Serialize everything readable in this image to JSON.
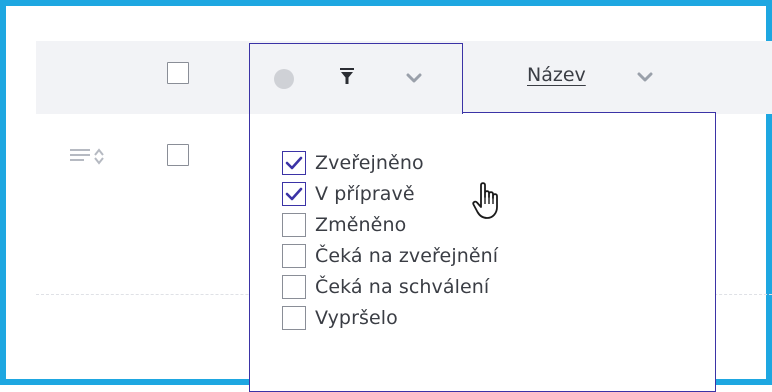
{
  "table": {
    "name_column": {
      "label": "Název"
    }
  },
  "status_filter": {
    "options": [
      {
        "label": "Zveřejněno",
        "checked": true
      },
      {
        "label": "V přípravě",
        "checked": true
      },
      {
        "label": "Změněno",
        "checked": false
      },
      {
        "label": "Čeká na zveřejnění",
        "checked": false
      },
      {
        "label": "Čeká na schválení",
        "checked": false
      },
      {
        "label": "Vypršelo",
        "checked": false
      }
    ]
  },
  "icons": {
    "status": "status-dot-icon",
    "filter": "filter-icon",
    "chevron": "chevron-down-icon",
    "row_sort": "drag-sort-icon",
    "cursor": "hand-pointer-cursor"
  },
  "colors": {
    "frame": "#1ea7e1",
    "accent": "#3b33a6",
    "header_bg": "#f2f3f6",
    "text": "#3a3d44"
  }
}
